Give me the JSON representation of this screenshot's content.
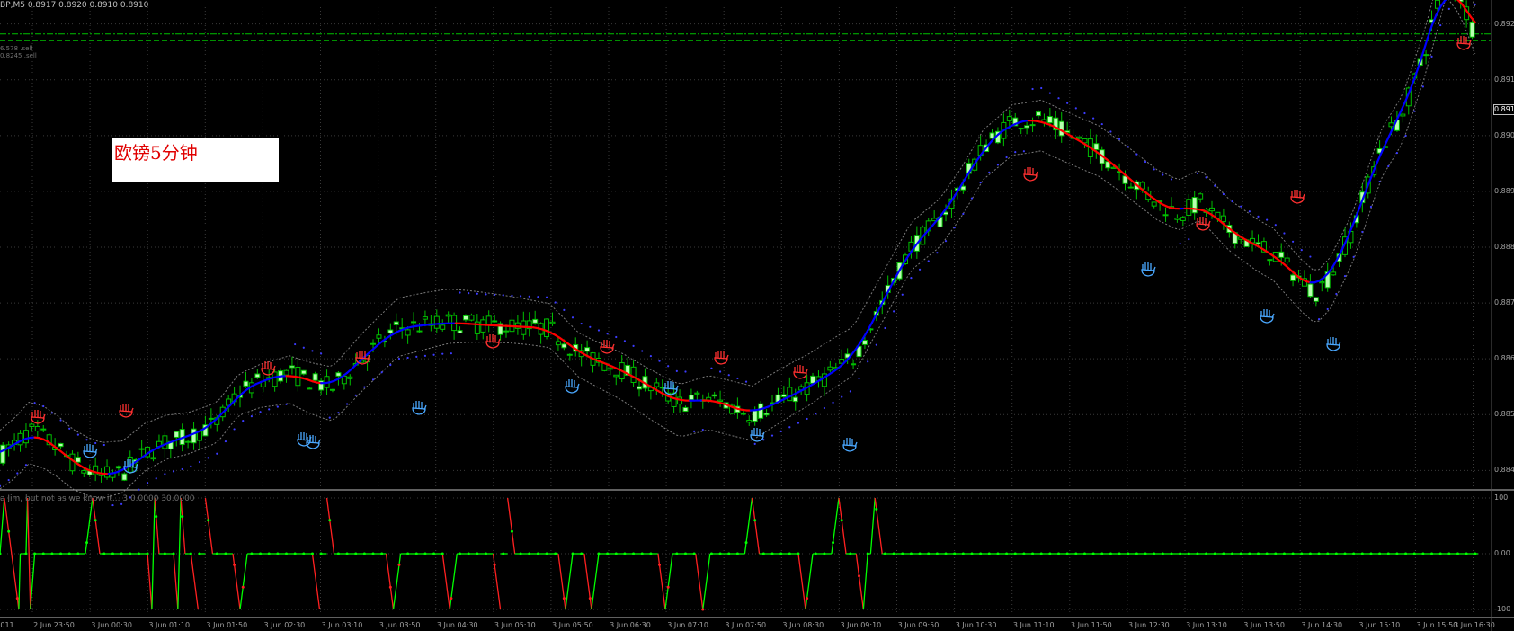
{
  "header": {
    "symbol_quote": "BP,M5  0.8917 0.8920 0.8910 0.8910",
    "indicator_title": "a Jim, but not as we know it... 3 0.0000 30.0000"
  },
  "level_labels": [
    "6.578 .sell",
    "0.8245 .sell"
  ],
  "annotation": {
    "text": "欧镑5分钟",
    "box_color": "#ffffff",
    "text_color": "#e00000"
  },
  "price_axis": {
    "labels": [
      "0.892",
      "0.891",
      "0.890",
      "0.889",
      "0.888",
      "0.887",
      "0.886",
      "0.885",
      "0.884"
    ],
    "current_price": "0.891"
  },
  "oscillator_axis": {
    "labels": [
      "100",
      "0.00",
      "-100"
    ]
  },
  "time_axis": {
    "labels": [
      "011",
      "2 Jun 23:50",
      "3 Jun 00:30",
      "3 Jun 01:10",
      "3 Jun 01:50",
      "3 Jun 02:30",
      "3 Jun 03:10",
      "3 Jun 03:50",
      "3 Jun 04:30",
      "3 Jun 05:10",
      "3 Jun 05:50",
      "3 Jun 06:30",
      "3 Jun 07:10",
      "3 Jun 07:50",
      "3 Jun 08:30",
      "3 Jun 09:10",
      "3 Jun 09:50",
      "3 Jun 10:30",
      "3 Jun 11:10",
      "3 Jun 11:50",
      "3 Jun 12:30",
      "3 Jun 13:10",
      "3 Jun 13:50",
      "3 Jun 14:30",
      "3 Jun 15:10",
      "3 Jun 15:50",
      "3 Jun 16:30"
    ]
  },
  "colors": {
    "background": "#000000",
    "grid": "#3a3a3a",
    "bull_candle": "#b8ffb0",
    "candle_outline": "#00c000",
    "ma_up": "#0000ff",
    "ma_down": "#ff0000",
    "psar": "#3c3cff",
    "envelope": "#7a7a7a",
    "level_line": "#00c000",
    "osc_up": "#00ff00",
    "osc_down": "#ff2020",
    "hand_up": "#4aa8ff",
    "hand_down": "#ff3030"
  },
  "icons": {
    "top_marker": "red-hand-icon",
    "bottom_marker": "blue-hand-icon"
  },
  "chart_data": {
    "type": "candlestick",
    "symbol": "BP,M5",
    "ohlc": {
      "open": 0.8917,
      "high": 0.892,
      "low": 0.891,
      "close": 0.891
    },
    "ylim": [
      0.8837,
      0.8923
    ],
    "time_range": [
      "2 Jun 23:30",
      "3 Jun 16:30"
    ],
    "price_path": [
      [
        0,
        0.88427
      ],
      [
        10,
        0.88445
      ],
      [
        20,
        0.8847
      ],
      [
        30,
        0.8846
      ],
      [
        40,
        0.8844
      ],
      [
        50,
        0.88415
      ],
      [
        60,
        0.884
      ],
      [
        70,
        0.8839
      ],
      [
        85,
        0.88395
      ],
      [
        100,
        0.8843
      ],
      [
        115,
        0.8845
      ],
      [
        130,
        0.8846
      ],
      [
        150,
        0.88485
      ],
      [
        165,
        0.8854
      ],
      [
        180,
        0.8856
      ],
      [
        200,
        0.88575
      ],
      [
        215,
        0.8856
      ],
      [
        230,
        0.88548
      ],
      [
        250,
        0.886
      ],
      [
        275,
        0.88655
      ],
      [
        310,
        0.88665
      ],
      [
        340,
        0.8866
      ],
      [
        380,
        0.88655
      ],
      [
        400,
        0.8861
      ],
      [
        430,
        0.8858
      ],
      [
        450,
        0.8855
      ],
      [
        470,
        0.8852
      ],
      [
        490,
        0.8853
      ],
      [
        520,
        0.885
      ],
      [
        560,
        0.8855
      ],
      [
        590,
        0.886
      ],
      [
        610,
        0.887
      ],
      [
        630,
        0.888
      ],
      [
        650,
        0.8885
      ],
      [
        665,
        0.8891
      ],
      [
        680,
        0.8898
      ],
      [
        700,
        0.89025
      ],
      [
        720,
        0.8903
      ],
      [
        740,
        0.89
      ],
      [
        760,
        0.8897
      ],
      [
        780,
        0.88925
      ],
      [
        800,
        0.8888
      ],
      [
        815,
        0.8886
      ],
      [
        830,
        0.8888
      ],
      [
        850,
        0.8883
      ],
      [
        870,
        0.888
      ],
      [
        880,
        0.8879
      ],
      [
        900,
        0.8874
      ],
      [
        910,
        0.8872
      ],
      [
        920,
        0.8875
      ],
      [
        935,
        0.8883
      ],
      [
        955,
        0.8898
      ],
      [
        970,
        0.8904
      ],
      [
        985,
        0.8915
      ],
      [
        1000,
        0.8929
      ],
      [
        1010,
        0.8925
      ],
      [
        1020,
        0.8918
      ]
    ],
    "oscillator": {
      "range": [
        -100,
        100
      ],
      "peaks_at_100": [
        3,
        19,
        64,
        107,
        125,
        142,
        226,
        351,
        520,
        580,
        605
      ],
      "troughs_at_minus_100": [
        13,
        21,
        105,
        123,
        137,
        166,
        221,
        272,
        311,
        346,
        391,
        409,
        460,
        486,
        557,
        597
      ]
    }
  }
}
